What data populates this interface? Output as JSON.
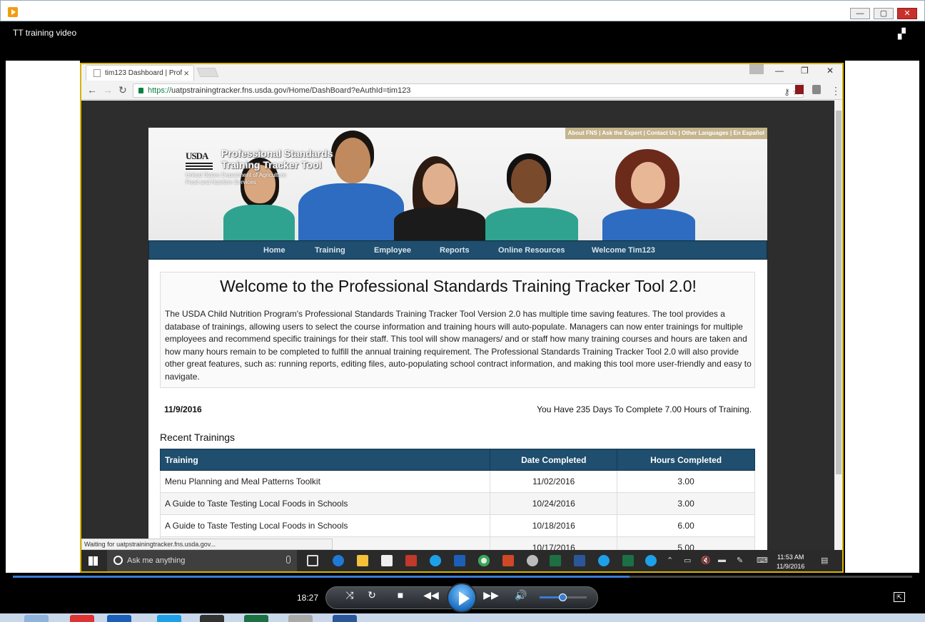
{
  "player": {
    "title": "TT training video",
    "current_time": "18:27",
    "progress_fraction": 0.686,
    "volume_fraction": 0.5,
    "controls": {
      "minimize": "—",
      "maximize": "▢",
      "close": "✕"
    }
  },
  "browser": {
    "tab_title": "tim123 Dashboard | Prof",
    "url_scheme": "https://",
    "url_rest": "uatpstrainingtracker.fns.usda.gov/Home/DashBoard?eAuthId=tim123",
    "status_text": "Waiting for uatpstrainingtracker.fns.usda.gov..."
  },
  "site": {
    "top_links": "About FNS | Ask the Expert | Contact Us | Other Languages | En Español",
    "usda_mark": "USDA",
    "brand_line1": "Professional Standards",
    "brand_line2": "Training Tracker Tool",
    "dept_line1": "United States Department of Agriculture",
    "dept_line2": "Food and Nutrition Services",
    "nav": [
      "Home",
      "Training",
      "Employee",
      "Reports",
      "Online Resources",
      "Welcome Tim123"
    ],
    "welcome_title": "Welcome to the Professional Standards Training Tracker Tool 2.0!",
    "welcome_body": "The USDA Child Nutrition Program's Professional Standards Training Tracker Tool Version 2.0 has multiple time saving features. The tool provides a database of trainings, allowing users to select the course information and training hours will auto-populate. Managers can now enter trainings for multiple employees and recommend specific trainings for their staff. This tool will show managers/ and or staff how many training courses and hours are taken and how many hours remain to be completed to fulfill the annual training requirement. The Professional Standards Training Tracker Tool 2.0 will also provide other great features, such as: running reports, editing files, auto-populating school contract information, and making this tool more user-friendly and easy to navigate.",
    "date": "11/9/2016",
    "days_remaining": "You Have 235 Days To Complete 7.00 Hours of Training.",
    "recent_title": "Recent Trainings",
    "table_headers": [
      "Training",
      "Date Completed",
      "Hours Completed"
    ],
    "table_rows": [
      [
        "Menu Planning and Meal Patterns Toolkit",
        "11/02/2016",
        "3.00"
      ],
      [
        "A Guide to Taste Testing Local Foods in Schools",
        "10/24/2016",
        "3.00"
      ],
      [
        "A Guide to Taste Testing Local Foods in Schools",
        "10/18/2016",
        "6.00"
      ],
      [
        "",
        "10/17/2016",
        "5.00"
      ]
    ]
  },
  "taskbar": {
    "search_placeholder": "Ask me anything",
    "time": "11:53 AM",
    "date": "11/9/2016"
  },
  "colors": {
    "nav_blue": "#1f4e6e",
    "toplinks_tan": "#c5b58d",
    "browser_border": "#d8b400",
    "seek_blue": "#3a7bd5"
  }
}
